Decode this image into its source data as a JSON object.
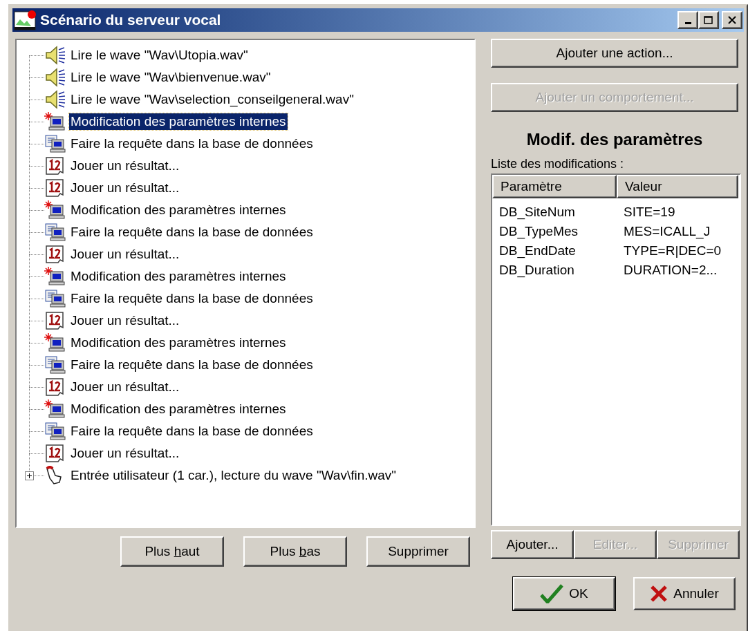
{
  "window": {
    "title": "Scénario du serveur vocal",
    "controls": [
      {
        "kind": "minimize"
      },
      {
        "kind": "maximize"
      },
      {
        "kind": "close"
      }
    ]
  },
  "tree": [
    {
      "kind": "wave",
      "label": "Lire le wave \"Wav\\Utopia.wav\"",
      "selected": false
    },
    {
      "kind": "wave",
      "label": "Lire le wave \"Wav\\bienvenue.wav\"",
      "selected": false
    },
    {
      "kind": "wave",
      "label": "Lire le wave \"Wav\\selection_conseilgeneral.wav\"",
      "selected": false
    },
    {
      "kind": "params",
      "label": "Modification des paramètres internes",
      "selected": true
    },
    {
      "kind": "query",
      "label": "Faire la requête dans la base de données",
      "selected": false
    },
    {
      "kind": "result",
      "label": "Jouer un résultat...",
      "selected": false
    },
    {
      "kind": "result",
      "label": "Jouer un résultat...",
      "selected": false
    },
    {
      "kind": "params",
      "label": "Modification des paramètres internes",
      "selected": false
    },
    {
      "kind": "query",
      "label": "Faire la requête dans la base de données",
      "selected": false
    },
    {
      "kind": "result",
      "label": "Jouer un résultat...",
      "selected": false
    },
    {
      "kind": "params",
      "label": "Modification des paramètres internes",
      "selected": false
    },
    {
      "kind": "query",
      "label": "Faire la requête dans la base de données",
      "selected": false
    },
    {
      "kind": "result",
      "label": "Jouer un résultat...",
      "selected": false
    },
    {
      "kind": "params",
      "label": "Modification des paramètres internes",
      "selected": false
    },
    {
      "kind": "query",
      "label": "Faire la requête dans la base de données",
      "selected": false
    },
    {
      "kind": "result",
      "label": "Jouer un résultat...",
      "selected": false
    },
    {
      "kind": "params",
      "label": "Modification des paramètres internes",
      "selected": false
    },
    {
      "kind": "query",
      "label": "Faire la requête dans la base de données",
      "selected": false
    },
    {
      "kind": "result",
      "label": "Jouer un résultat...",
      "selected": false
    },
    {
      "kind": "input",
      "label": "Entrée utilisateur (1 car.), lecture du wave \"Wav\\fin.wav\"",
      "selected": false,
      "expanded": false
    }
  ],
  "tree_buttons": [
    {
      "before": "Plus ",
      "key": "h",
      "after": "aut",
      "disabled": false
    },
    {
      "before": "Plus ",
      "key": "b",
      "after": "as",
      "disabled": false
    },
    {
      "before": "Supprimer",
      "disabled": false
    }
  ],
  "action_buttons": [
    {
      "label": "Ajouter une action...",
      "disabled": false
    },
    {
      "label": "Ajouter un comportement...",
      "disabled": true
    }
  ],
  "section_title": "Modif. des paramètres",
  "list_label": "Liste des modifications :",
  "table": {
    "columns": [
      "Paramètre",
      "Valeur"
    ],
    "rows": [
      [
        "DB_SiteNum",
        "SITE=19"
      ],
      [
        "DB_TypeMes",
        "MES=ICALL_J"
      ],
      [
        "DB_EndDate",
        "TYPE=R|DEC=0"
      ],
      [
        "DB_Duration",
        "DURATION=2..."
      ]
    ]
  },
  "table_buttons": [
    {
      "label": "Ajouter...",
      "disabled": false
    },
    {
      "label": "Editer...",
      "disabled": true
    },
    {
      "label": "Supprimer",
      "disabled": true
    }
  ],
  "dialog_buttons": [
    {
      "kind": "ok",
      "label": "OK"
    },
    {
      "kind": "cancel",
      "label": "Annuler"
    }
  ]
}
